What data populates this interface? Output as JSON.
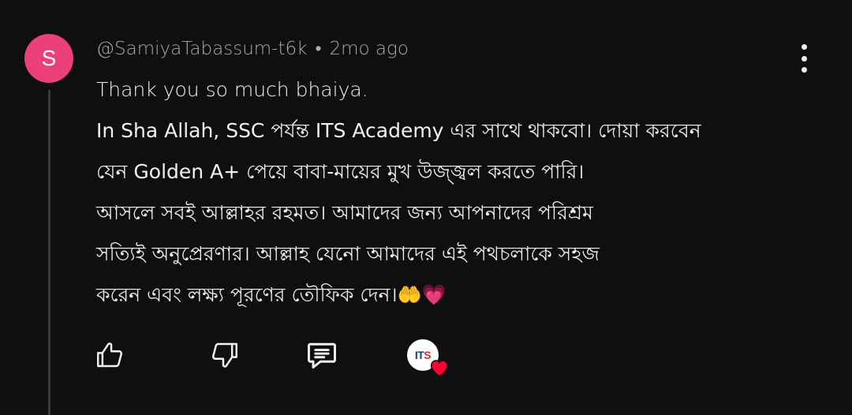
{
  "comment": {
    "author": "@SamiyaTabassum-t6k",
    "separator": "•",
    "time": "2mo ago",
    "avatar_letter": "S",
    "avatar_color": "#ec407a",
    "lines": [
      "Thank you so much bhaiya.",
      "In Sha Allah, SSC পর্যন্ত ITS Academy এর সাথে থাকবো। দোয়া করবেন",
      "যেন Golden A+ পেয়ে বাবা-মায়ের মুখ উজ্জ্বল করতে পারি।",
      "আসলে সবই আল্লাহর রহমত। আমাদের জন্য আপনাদের পরিশ্রম",
      "সত্যিই অনুপ্রেরণার। আল্লাহ যেনো আমাদের এই পথচলাকে সহজ",
      "করেন এবং লক্ষ্য পূরণের তৌফিক দেন।🤲💗"
    ]
  },
  "actions": {
    "like_icon": "thumbs-up-icon",
    "dislike_icon": "thumbs-down-icon",
    "reply_icon": "reply-comment-icon",
    "creator_heart": {
      "avatar_text_1": "IT",
      "avatar_text_2": "S",
      "heart_color": "#ff0033"
    }
  },
  "menu_icon": "more-vertical-icon"
}
